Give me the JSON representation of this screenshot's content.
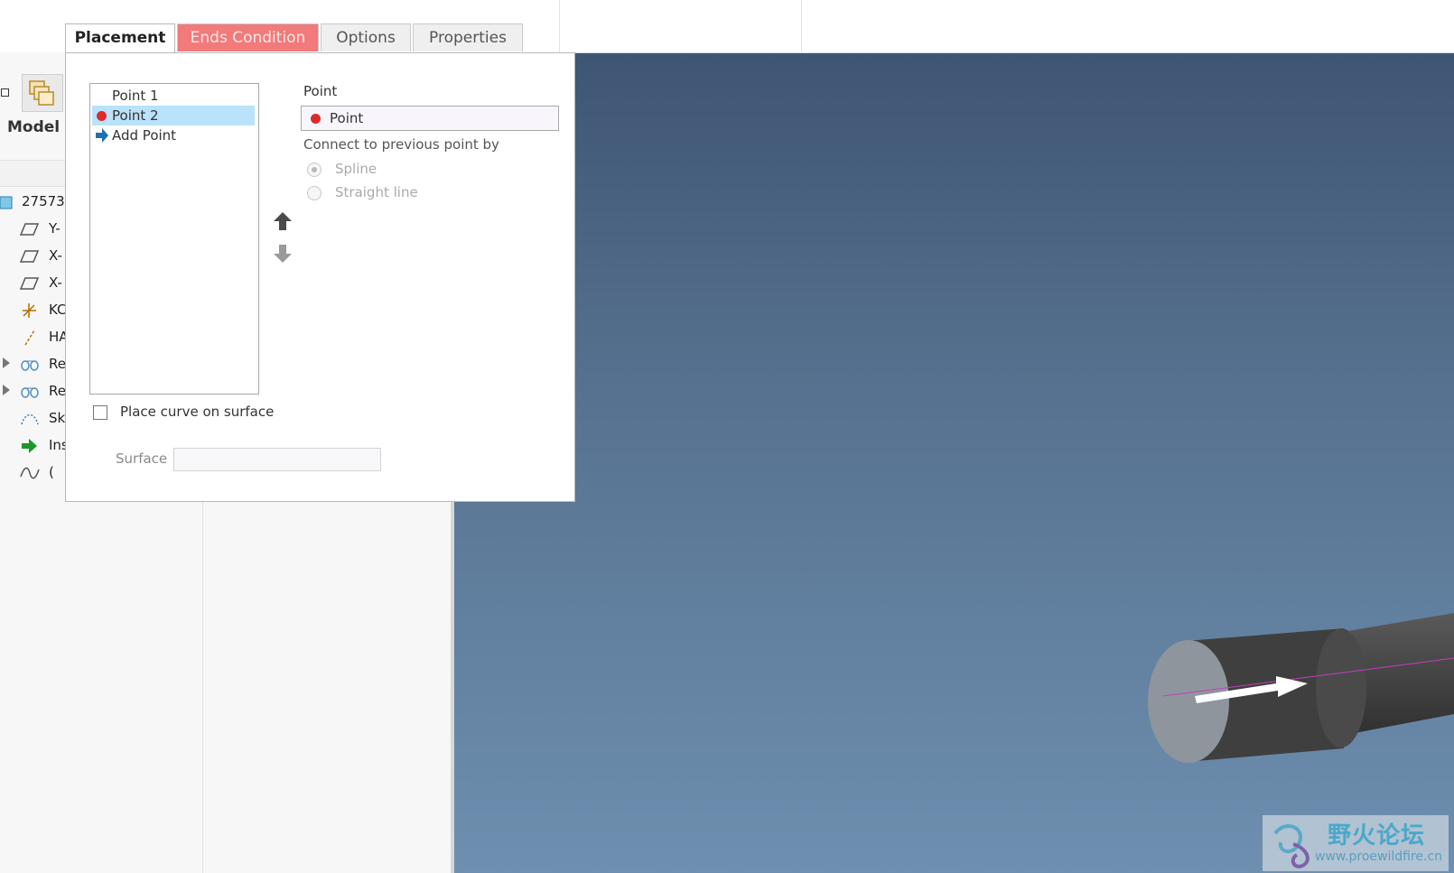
{
  "tabs": [
    {
      "label": "Placement",
      "state": "active"
    },
    {
      "label": "Ends Condition",
      "state": "error"
    },
    {
      "label": "Options",
      "state": "normal"
    },
    {
      "label": "Properties",
      "state": "normal"
    }
  ],
  "placement": {
    "points": [
      {
        "label": "Point 1",
        "selected": false,
        "icon": null
      },
      {
        "label": "Point 2",
        "selected": true,
        "icon": "red-dot-icon"
      },
      {
        "label": "Add Point",
        "selected": false,
        "icon": "add-arrow-icon"
      }
    ],
    "point_field_label": "Point",
    "point_field_value": "Point",
    "connect_label": "Connect to previous point by",
    "connect_options": [
      {
        "label": "Spline",
        "selected": true,
        "enabled": false
      },
      {
        "label": "Straight line",
        "selected": false,
        "enabled": false
      }
    ],
    "place_on_surface_label": "Place curve on surface",
    "place_on_surface_checked": false,
    "surface_label": "Surface",
    "surface_value": ""
  },
  "model_tree": {
    "title": "Model T",
    "items": [
      {
        "label": "27573",
        "icon": "part-icon",
        "expandable": false
      },
      {
        "label": "Y-",
        "icon": "datum-plane-icon",
        "expandable": false
      },
      {
        "label": "X-",
        "icon": "datum-plane-icon",
        "expandable": false
      },
      {
        "label": "X-",
        "icon": "datum-plane-icon",
        "expandable": false
      },
      {
        "label": "KC",
        "icon": "coordinate-system-icon",
        "expandable": false
      },
      {
        "label": "HA",
        "icon": "axis-icon",
        "expandable": false
      },
      {
        "label": "Re",
        "icon": "revolve-icon",
        "expandable": true
      },
      {
        "label": "Re",
        "icon": "revolve-icon",
        "expandable": true
      },
      {
        "label": "Sk",
        "icon": "sketch-icon",
        "expandable": false
      },
      {
        "label": "Ins",
        "icon": "insert-here-icon",
        "expandable": false
      },
      {
        "label": "(",
        "icon": "curve-icon",
        "expandable": false
      }
    ]
  },
  "watermark": {
    "text_cn": "野火论坛",
    "url": "www.proewildfire.cn"
  },
  "colors": {
    "error_tab": "#f27a7a",
    "selection": "#b9e2fb",
    "point_marker": "#dd2a2a",
    "viewport_top": "#3e5573",
    "viewport_bottom": "#6e8fb0"
  }
}
